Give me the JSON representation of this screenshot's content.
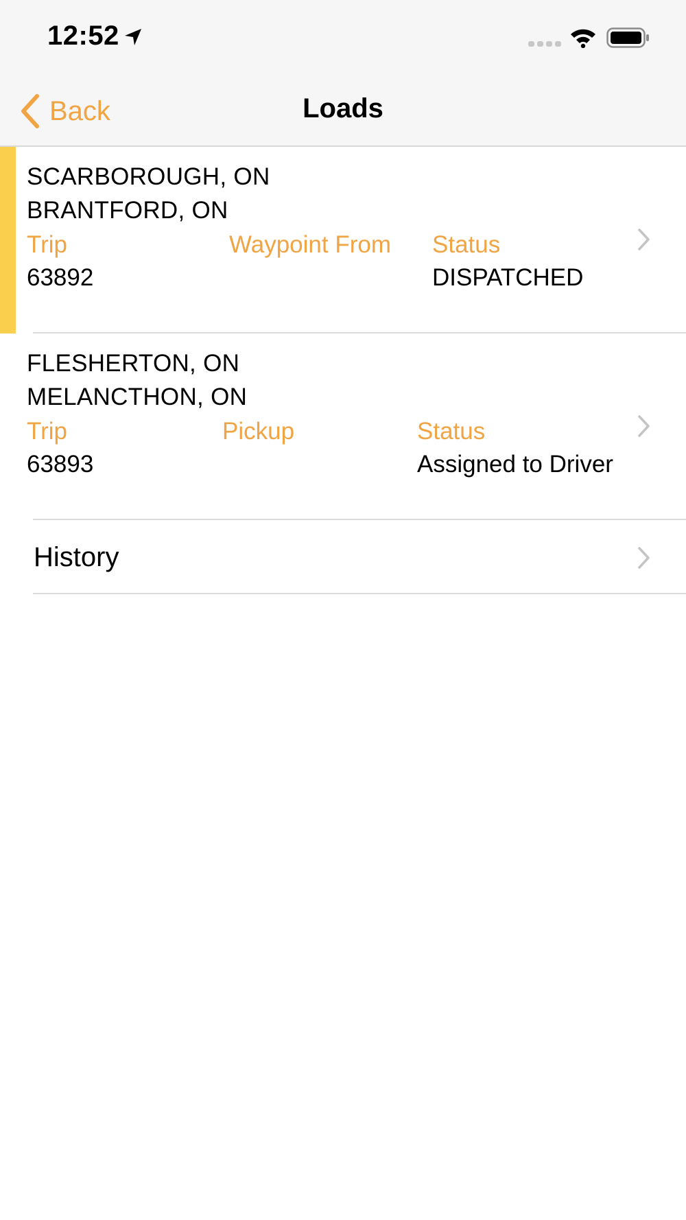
{
  "status_bar": {
    "time": "12:52",
    "icons": [
      "location-arrow-icon",
      "cellular-signal-icon",
      "wifi-icon",
      "battery-icon"
    ]
  },
  "nav": {
    "back_label": "Back",
    "title": "Loads"
  },
  "loads": [
    {
      "origin": "SCARBOROUGH, ON",
      "destination": "BRANTFORD, ON",
      "trip_label": "Trip",
      "trip": "63892",
      "waypoint_label": "Waypoint From",
      "waypoint": "",
      "status_label": "Status",
      "status": "DISPATCHED",
      "highlighted": true
    },
    {
      "origin": "FLESHERTON, ON",
      "destination": "MELANCTHON, ON",
      "trip_label": "Trip",
      "trip": "63893",
      "waypoint_label": "Pickup",
      "waypoint": "",
      "status_label": "Status",
      "status": "Assigned to Driver",
      "highlighted": false
    }
  ],
  "history": {
    "label": "History"
  },
  "colors": {
    "accent_orange": "#f0a443",
    "highlight_yellow": "#f9cf4d",
    "bar_background": "#f6f6f6",
    "divider": "#dcdcdc",
    "chevron_gray": "#c4c4c6"
  }
}
